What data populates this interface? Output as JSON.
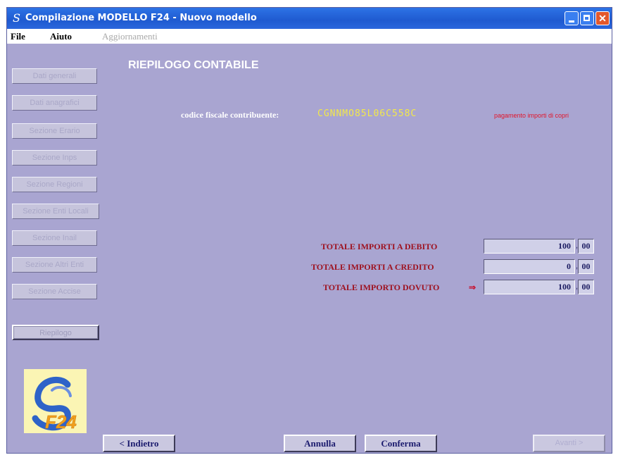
{
  "window": {
    "icon_glyph": "S",
    "title": "Compilazione MODELLO F24 - Nuovo modello",
    "close_glyph": "✕"
  },
  "menu": {
    "file": "File",
    "aiuto": "Aiuto",
    "aggiornamenti": "Aggiornamenti"
  },
  "sidebar": {
    "items": [
      {
        "label": "Dati generali"
      },
      {
        "label": "Dati anagrafici"
      },
      {
        "label": "Sezione Erario"
      },
      {
        "label": "Sezione Inps"
      },
      {
        "label": "Sezione Regioni"
      },
      {
        "label": "Sezione Enti Locali"
      },
      {
        "label": "Sezione Inail"
      },
      {
        "label": "Sezione Altri Enti"
      },
      {
        "label": "Sezione Accise"
      },
      {
        "label": "Riepilogo"
      }
    ]
  },
  "main": {
    "heading": "RIEPILOGO CONTABILE",
    "cf_label": "codice fiscale contribuente:",
    "cf_value": "CGNNMO85L06C558C",
    "cf_note": "pagamento importi di copri",
    "totals": [
      {
        "label": "TOTALE IMPORTI A DEBITO",
        "euro": "100",
        "cents": "00"
      },
      {
        "label": "TOTALE IMPORTI A CREDITO",
        "euro": "0",
        "cents": "00"
      },
      {
        "label": "TOTALE IMPORTO DOVUTO",
        "euro": "100",
        "cents": "00"
      }
    ],
    "arrow": "⇒",
    "decimal_sep": ","
  },
  "logo": {
    "text": "F24"
  },
  "buttons": {
    "indietro": "< Indietro",
    "annulla": "Annulla",
    "conferma": "Conferma",
    "avanti": "Avanti >"
  },
  "colors": {
    "window_bg": "#a9a5d1",
    "titlebar": "#1f5ad0",
    "heading": "#ffffff",
    "cf_value": "#f2e84a",
    "totals_label": "#9e1220",
    "note": "#e2152a"
  }
}
